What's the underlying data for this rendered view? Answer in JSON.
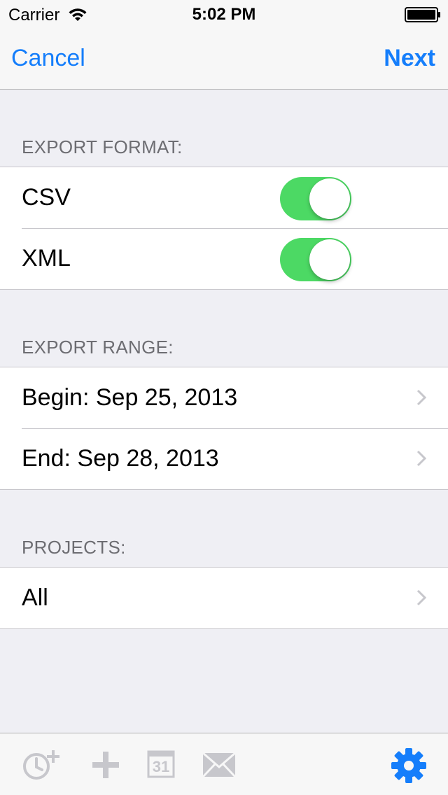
{
  "status_bar": {
    "carrier": "Carrier",
    "time": "5:02 PM"
  },
  "nav": {
    "cancel_label": "Cancel",
    "next_label": "Next"
  },
  "sections": {
    "export_format": {
      "header": "EXPORT FORMAT:",
      "items": [
        {
          "label": "CSV",
          "enabled": true
        },
        {
          "label": "XML",
          "enabled": true
        }
      ]
    },
    "export_range": {
      "header": "EXPORT RANGE:",
      "items": [
        {
          "label": "Begin: Sep 25, 2013"
        },
        {
          "label": "End: Sep 28, 2013"
        }
      ]
    },
    "projects": {
      "header": "PROJECTS:",
      "items": [
        {
          "label": "All"
        }
      ]
    }
  },
  "toolbar": {
    "icons": [
      "timer-add-icon",
      "plus-icon",
      "calendar-icon",
      "mail-icon",
      "gear-icon"
    ],
    "calendar_day": "31"
  },
  "colors": {
    "accent": "#157efb",
    "toggle_on": "#4cd964",
    "background": "#efeff4",
    "disabled_icon": "#c7c7cc"
  }
}
